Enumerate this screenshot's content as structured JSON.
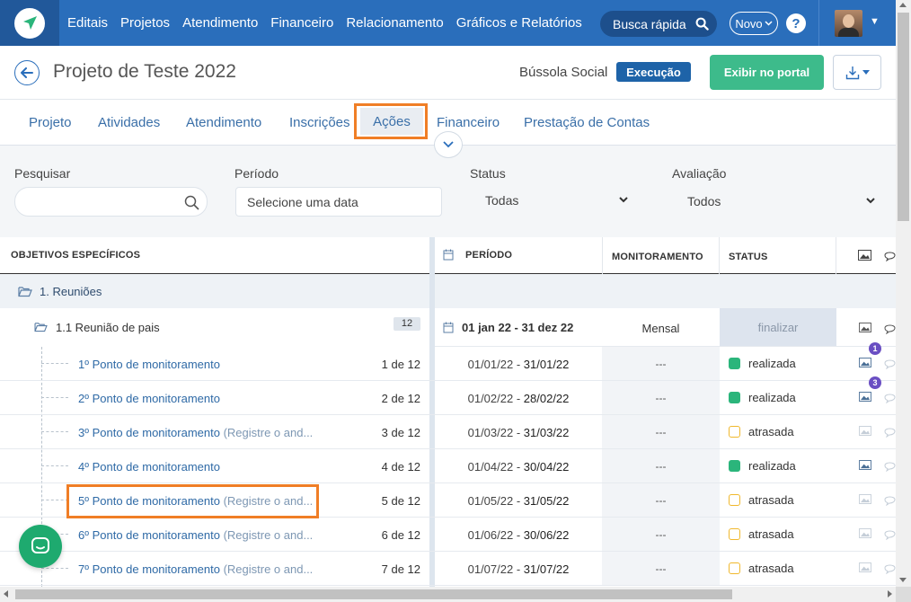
{
  "nav": {
    "items": [
      "Editais",
      "Projetos",
      "Atendimento",
      "Financeiro",
      "Relacionamento",
      "Gráficos e Relatórios"
    ],
    "search_label": "Busca rápida",
    "new_label": "Novo",
    "help_label": "?"
  },
  "header": {
    "title": "Projeto de Teste 2022",
    "org": "Bússola Social",
    "status": "Execução",
    "portal_button": "Exibir no portal"
  },
  "tabs": [
    "Projeto",
    "Atividades",
    "Atendimento",
    "Inscrições",
    "Ações",
    "Financeiro",
    "Prestação de Contas"
  ],
  "active_tab": "Ações",
  "filters": {
    "search_label": "Pesquisar",
    "period_label": "Período",
    "period_placeholder": "Selecione uma data",
    "status_label": "Status",
    "status_value": "Todas",
    "evaluation_label": "Avaliação",
    "evaluation_value": "Todos"
  },
  "table": {
    "headers": {
      "objectives": "OBJETIVOS ESPECÍFICOS",
      "period": "PERÍODO",
      "monitoring": "MONITORAMENTO",
      "status": "STATUS"
    },
    "group": "1. Reuniões",
    "subgroup": {
      "name": "1.1 Reunião de pais",
      "count": "12",
      "period": "01 jan 22 - 31 dez 22",
      "monitoring": "Mensal",
      "action": "finalizar"
    },
    "rows": [
      {
        "name": "1º Ponto de monitoramento",
        "extra": "",
        "count": "1 de 12",
        "start": "01/01/22",
        "end": "31/01/22",
        "monitoring": "---",
        "status": "realizada",
        "state": "ok",
        "badge": "1"
      },
      {
        "name": "2º Ponto de monitoramento",
        "extra": "",
        "count": "2 de 12",
        "start": "01/02/22",
        "end": "28/02/22",
        "monitoring": "---",
        "status": "realizada",
        "state": "ok",
        "badge": "3"
      },
      {
        "name": "3º Ponto de monitoramento",
        "extra": " (Registre o and...",
        "count": "3 de 12",
        "start": "01/03/22",
        "end": "31/03/22",
        "monitoring": "---",
        "status": "atrasada",
        "state": "late",
        "badge": ""
      },
      {
        "name": "4º Ponto de monitoramento",
        "extra": "",
        "count": "4 de 12",
        "start": "01/04/22",
        "end": "30/04/22",
        "monitoring": "---",
        "status": "realizada",
        "state": "ok",
        "badge": ""
      },
      {
        "name": "5º Ponto de monitoramento",
        "extra": " (Registre o and...",
        "count": "5 de 12",
        "start": "01/05/22",
        "end": "31/05/22",
        "monitoring": "---",
        "status": "atrasada",
        "state": "late",
        "badge": ""
      },
      {
        "name": "6º Ponto de monitoramento",
        "extra": " (Registre o and...",
        "count": "6 de 12",
        "start": "01/06/22",
        "end": "30/06/22",
        "monitoring": "---",
        "status": "atrasada",
        "state": "late",
        "badge": ""
      },
      {
        "name": "7º Ponto de monitoramento",
        "extra": " (Registre o and...",
        "count": "7 de 12",
        "start": "01/07/22",
        "end": "31/07/22",
        "monitoring": "---",
        "status": "atrasada",
        "state": "late",
        "badge": ""
      }
    ]
  },
  "colors": {
    "nav_bg": "#2a6ebb",
    "accent_orange": "#f07e26",
    "done_green": "#2bb57b",
    "late_yellow": "#f0b82d",
    "portal_green": "#3dbb8b"
  }
}
